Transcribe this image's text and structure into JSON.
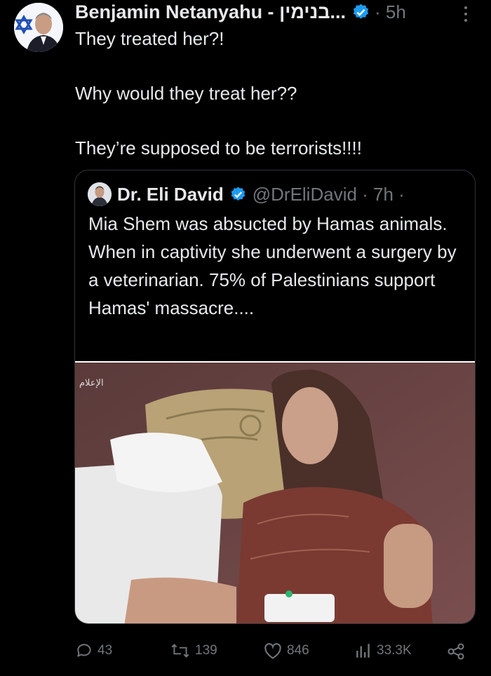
{
  "tweet": {
    "author_name": "Benjamin Netanyahu - בנימין...",
    "time": "· 5h",
    "lines": [
      "They treated her?!",
      "Why would they treat her??",
      "They’re supposed to be terrorists!!!!"
    ]
  },
  "quote": {
    "author_name": "Dr. Eli David",
    "handle": "@DrEliDavid · 7h ·",
    "text": "Mia Shem was absucted by Hamas animals. When in captivity she underwent a surgery by a veterinarian. 75% of Palestinians support Hamas' massacre....",
    "image_watermark": "الإعلام"
  },
  "actions": {
    "replies": "43",
    "retweets": "139",
    "likes": "846",
    "views": "33.3K"
  },
  "colors": {
    "verified": "#1d9bf0",
    "muted": "#71767b",
    "text": "#e7e9ea"
  },
  "icons": [
    "verified-badge-icon",
    "more-icon",
    "reply-icon",
    "retweet-icon",
    "like-icon",
    "views-icon",
    "share-icon"
  ]
}
